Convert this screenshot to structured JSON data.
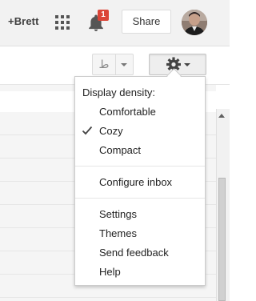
{
  "header": {
    "user_link": "+Brett",
    "apps_icon": "apps-grid-icon",
    "notifications_icon": "bell-icon",
    "notification_count": "1",
    "share_label": "Share",
    "avatar_icon": "user-avatar"
  },
  "toolbar": {
    "input_tools_icon": "input-tools-icon",
    "input_tools_glyph": "ط",
    "dropdown_icon": "chevron-down-icon",
    "settings_icon": "gear-icon"
  },
  "menu": {
    "heading": "Display density:",
    "density_options": [
      {
        "label": "Comfortable",
        "selected": false
      },
      {
        "label": "Cozy",
        "selected": true
      },
      {
        "label": "Compact",
        "selected": false
      }
    ],
    "configure_inbox": "Configure inbox",
    "items": [
      {
        "label": "Settings"
      },
      {
        "label": "Themes"
      },
      {
        "label": "Send feedback"
      },
      {
        "label": "Help"
      }
    ],
    "check_icon": "checkmark-icon"
  },
  "colors": {
    "badge": "#db4437",
    "header_bg": "#f2f2f2",
    "menu_text": "#222222"
  }
}
